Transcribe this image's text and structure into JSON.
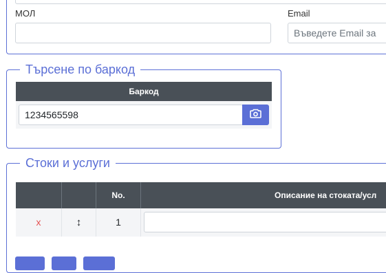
{
  "contact": {
    "mol_label": "МОЛ",
    "mol_value": "",
    "email_label": "Email",
    "email_placeholder": "Въведете Email за"
  },
  "barcode_search": {
    "legend": "Търсене по баркод",
    "column_header": "Баркод",
    "input_value": "1234565598",
    "button_icon": "camera-icon"
  },
  "goods": {
    "legend": "Стоки и услуги",
    "columns": [
      "",
      "",
      "No.",
      "Описание на стоката/усл"
    ],
    "rows": [
      {
        "delete_symbol": "x",
        "move_symbol": "↕",
        "number": "1",
        "description": ""
      }
    ],
    "delete_color": "#e55353"
  },
  "colors": {
    "accent": "#5b6fd6",
    "table_header": "#495057"
  }
}
